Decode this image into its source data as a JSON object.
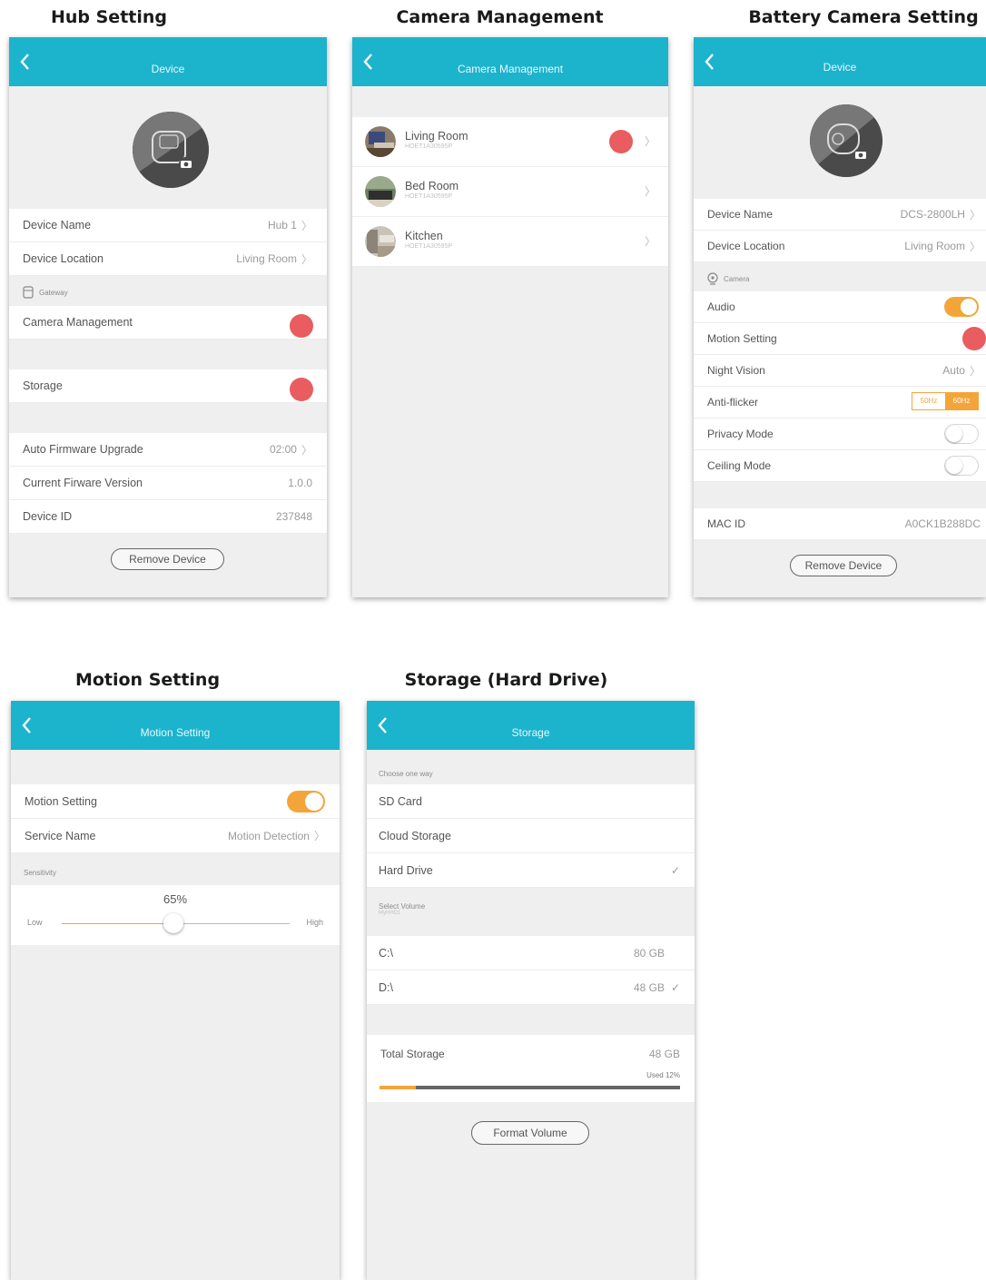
{
  "titles": {
    "hub": "Hub Setting",
    "camera_mgmt": "Camera Management",
    "battery": "Battery Camera Setting",
    "motion": "Motion Setting",
    "storage": "Storage (Hard Drive)"
  },
  "hub": {
    "header": "Device",
    "device_name_label": "Device Name",
    "device_name_value": "Hub 1",
    "device_location_label": "Device Location",
    "device_location_value": "Living Room",
    "group_label": "Gateway",
    "camera_management_label": "Camera Management",
    "storage_label": "Storage",
    "auto_firmware_label": "Auto Firmware Upgrade",
    "auto_firmware_value": "02:00",
    "current_firmware_label": "Current Firware Version",
    "current_firmware_value": "1.0.0",
    "device_id_label": "Device ID",
    "device_id_value": "237848",
    "remove_label": "Remove Device"
  },
  "camera_mgmt": {
    "header": "Camera Management",
    "cameras": [
      {
        "name": "Living Room",
        "serial": "HOET1A30595P"
      },
      {
        "name": "Bed Room",
        "serial": "HOET1A30595P"
      },
      {
        "name": "Kitchen",
        "serial": "HOET1A30595P"
      }
    ]
  },
  "battery": {
    "header": "Device",
    "device_name_label": "Device Name",
    "device_name_value": "DCS-2800LH",
    "device_location_label": "Device Location",
    "device_location_value": "Living Room",
    "group_label": "Camera",
    "audio_label": "Audio",
    "motion_label": "Motion Setting",
    "night_vision_label": "Night Vision",
    "night_vision_value": "Auto",
    "anti_flicker_label": "Anti-flicker",
    "anti_flicker_opt1": "50Hz",
    "anti_flicker_opt2": "60Hz",
    "privacy_label": "Privacy Mode",
    "ceiling_label": "Ceiling Mode",
    "mac_label": "MAC ID",
    "mac_value": "A0CK1B288DC",
    "remove_label": "Remove Device"
  },
  "motion": {
    "header": "Motion Setting",
    "motion_label": "Motion Setting",
    "service_label": "Service Name",
    "service_value": "Motion Detection",
    "sensitivity_label": "Sensitivity",
    "sensitivity_value": "65%",
    "sensitivity_fraction": 0.49,
    "low_label": "Low",
    "high_label": "High"
  },
  "storage": {
    "header": "Storage",
    "choose_label": "Choose one way",
    "sd_label": "SD Card",
    "cloud_label": "Cloud Storage",
    "hdd_label": "Hard Drive",
    "select_volume_label": "Select Volume",
    "select_volume_sub": "MyHHD1",
    "volumes": [
      {
        "name": "C:\\",
        "size": "80 GB"
      },
      {
        "name": "D:\\",
        "size": "48 GB"
      }
    ],
    "total_label": "Total Storage",
    "total_value": "48 GB",
    "used_label": "Used 12%",
    "used_fraction": 0.12,
    "format_label": "Format Volume"
  },
  "colors": {
    "header": "#1cb3cd",
    "accent": "#f3a53a",
    "red_marker": "#e95c5f"
  }
}
